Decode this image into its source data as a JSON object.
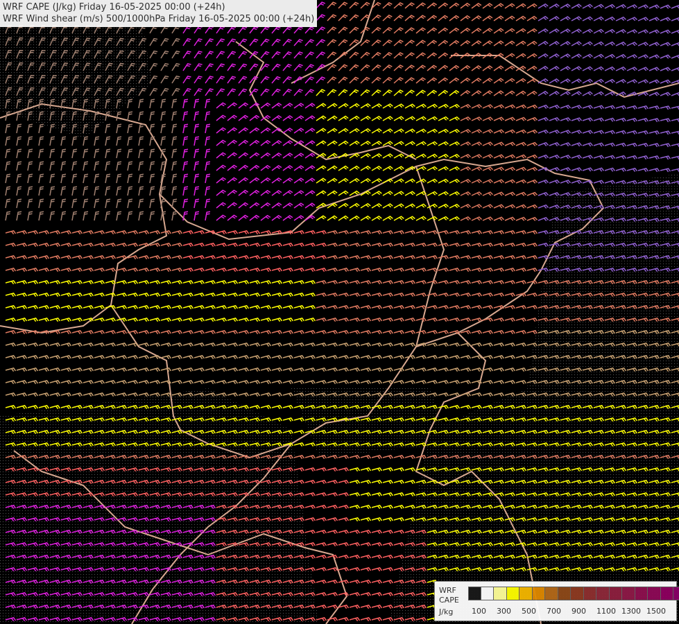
{
  "header": {
    "line1": "WRF CAPE (J/kg) Friday 16-05-2025 00:00 (+24h)",
    "line2": "WRF Wind shear (m/s) 500/1000hPa Friday 16-05-2025 00:00 (+24h)"
  },
  "legend": {
    "label_line1": "WRF",
    "label_line2": "CAPE",
    "unit": "J/kg",
    "colors": [
      "#1a1a1a",
      "#ffffff",
      "#ffff99",
      "#ffff00",
      "#f5b800",
      "#e08a00",
      "#b56a1a",
      "#8f4a1a",
      "#8f3c22",
      "#8f3030",
      "#8f2a3a",
      "#8f2040",
      "#8f1a48",
      "#8f1050",
      "#8f0a58",
      "#8f0060",
      "#8a0068"
    ],
    "ticks": [
      "100",
      "300",
      "500",
      "700",
      "900",
      "1100",
      "1300",
      "1500"
    ]
  },
  "shear_colors": {
    "low": "#a08070",
    "moderate": "#e07a60",
    "elevated": "#ff6060",
    "high": "#ffff00",
    "very_high": "#e020e0",
    "extreme": "#9060d0",
    "cape_tan": "#c8a070"
  }
}
